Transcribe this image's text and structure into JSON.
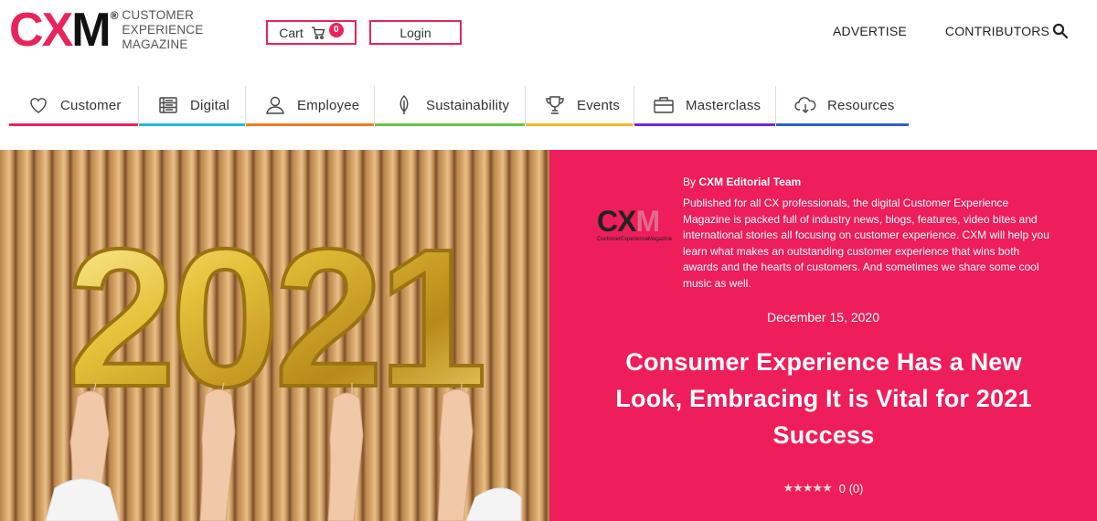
{
  "header": {
    "logo_reg": "®",
    "logo_text": [
      "CUSTOMER",
      "EXPERIENCE",
      "MAGAZINE"
    ],
    "cart_label": "Cart",
    "cart_count": "0",
    "login_label": "Login",
    "links": [
      "ADVERTISE",
      "CONTRIBUTORS"
    ]
  },
  "categories": [
    {
      "label": "Customer",
      "icon": "heart-icon",
      "color": "#e8245c"
    },
    {
      "label": "Digital",
      "icon": "server-icon",
      "color": "#22b8e0"
    },
    {
      "label": "Employee",
      "icon": "person-icon",
      "color": "#f07b22"
    },
    {
      "label": "Sustainability",
      "icon": "leaf-icon",
      "color": "#6cc24a"
    },
    {
      "label": "Events",
      "icon": "trophy-icon",
      "color": "#f5b82e"
    },
    {
      "label": "Masterclass",
      "icon": "briefcase-icon",
      "color": "#6a2bd8"
    },
    {
      "label": "Resources",
      "icon": "cloud-download-icon",
      "color": "#2f5fc8"
    }
  ],
  "hero": {
    "image_text": "2021",
    "by": "By",
    "author": "CXM Editorial Team",
    "bio": "Published for all CX professionals, the digital Customer Experience Magazine is packed full of industry news, blogs, features, video bites and international stories all focusing on customer experience. CXM will help you learn what makes an outstanding customer experience that wins both awards and the hearts of customers. And sometimes we share some cool music as well.",
    "author_logo_small": "CustomerExperienceMagazine",
    "date": "December 15, 2020",
    "title": "Consumer Experience Has a New Look, Embracing It is Vital for 2021 Success",
    "stars": "★★★★★",
    "rating": "0 (0)",
    "rating_value": 0
  },
  "colors": {
    "brand": "#e8245c",
    "hero_panel": "#ed1e59"
  }
}
